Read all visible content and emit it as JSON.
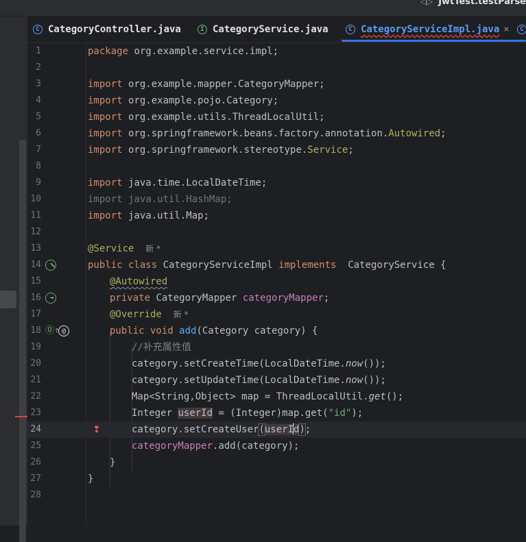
{
  "run_config": {
    "icon": "run-config-icon",
    "label": "JwtTest.testParse"
  },
  "tabs": [
    {
      "label": "CategoryController.java",
      "icon": "class-icon",
      "active": false
    },
    {
      "label": "CategoryService.java",
      "icon": "interface-icon",
      "active": false
    },
    {
      "label": "CategoryServiceImpl.java",
      "icon": "class-icon",
      "active": true,
      "close": "×"
    }
  ],
  "editor": {
    "current_line": 24,
    "line_numbers": [
      "1",
      "2",
      "3",
      "4",
      "5",
      "6",
      "7",
      "8",
      "9",
      "10",
      "11",
      "12",
      "13",
      "14",
      "15",
      "16",
      "17",
      "18",
      "19",
      "20",
      "21",
      "22",
      "23",
      "24",
      "25",
      "26",
      "27",
      "28"
    ],
    "lines": {
      "l1": {
        "kw": "package",
        "rest": " org.example.service.impl;"
      },
      "l3": {
        "kw": "import",
        "rest": " org.example.mapper.CategoryMapper;"
      },
      "l4": {
        "kw": "import",
        "rest": " org.example.pojo.Category;"
      },
      "l5": {
        "kw": "import",
        "rest": " org.example.utils.ThreadLocalUtil;"
      },
      "l6": {
        "kw": "import",
        "rest": " org.springframework.beans.factory.annotation.",
        "hl": "Autowired",
        "end": ";"
      },
      "l7": {
        "kw": "import",
        "rest": " org.springframework.stereotype.",
        "hl": "Service",
        "end": ";"
      },
      "l9": {
        "kw": "import",
        "rest": " java.time.LocalDateTime;"
      },
      "l10": {
        "text": "import java.util.HashMap;"
      },
      "l11": {
        "kw": "import",
        "rest": " java.util.Map;"
      },
      "l13": {
        "ann": "@Service",
        "hint": "新 *"
      },
      "l14": {
        "kw1": "public class",
        "name": " CategoryServiceImpl ",
        "kw2": "implements",
        "rest": "  CategoryService {"
      },
      "l15": {
        "ann": "@Autowired"
      },
      "l16": {
        "kw": "private",
        "type": " CategoryMapper ",
        "field": "categoryMapper",
        "end": ";"
      },
      "l17": {
        "ann": "@Override",
        "hint": "新 *"
      },
      "l18": {
        "kw": "public void",
        "fn": " add",
        "rest": "(Category category) {"
      },
      "l19": {
        "comment": "//补充属性值"
      },
      "l20": {
        "a": "category.setCreateTime(LocalDateTime.",
        "it": "now",
        "b": "());"
      },
      "l21": {
        "a": "category.setUpdateTime(LocalDateTime.",
        "it": "now",
        "b": "());"
      },
      "l22": {
        "a": "Map<String,Object> map = ThreadLocalUtil.",
        "it": "get",
        "b": "();"
      },
      "l23": {
        "a": "Integer ",
        "var": "userId",
        "b": " = (Integer)map.get(",
        "str": "\"id\"",
        "c": ");"
      },
      "l24": {
        "a": "category.setCreateUser",
        "p1": "(",
        "var": "userI",
        "var2": "d",
        "p2": ")",
        "end": ";"
      },
      "l25": {
        "field": "categoryMapper",
        "rest": ".add(category);"
      },
      "l26": {
        "text": "}"
      },
      "l27": {
        "text": "}"
      }
    },
    "gutter_icons": {
      "l14": "implemented-icon",
      "l16": "bean-navigation-icon",
      "l18": "overriding-icon",
      "l18b": "mapping-at-icon",
      "l24": "error-bulb-icon"
    }
  }
}
